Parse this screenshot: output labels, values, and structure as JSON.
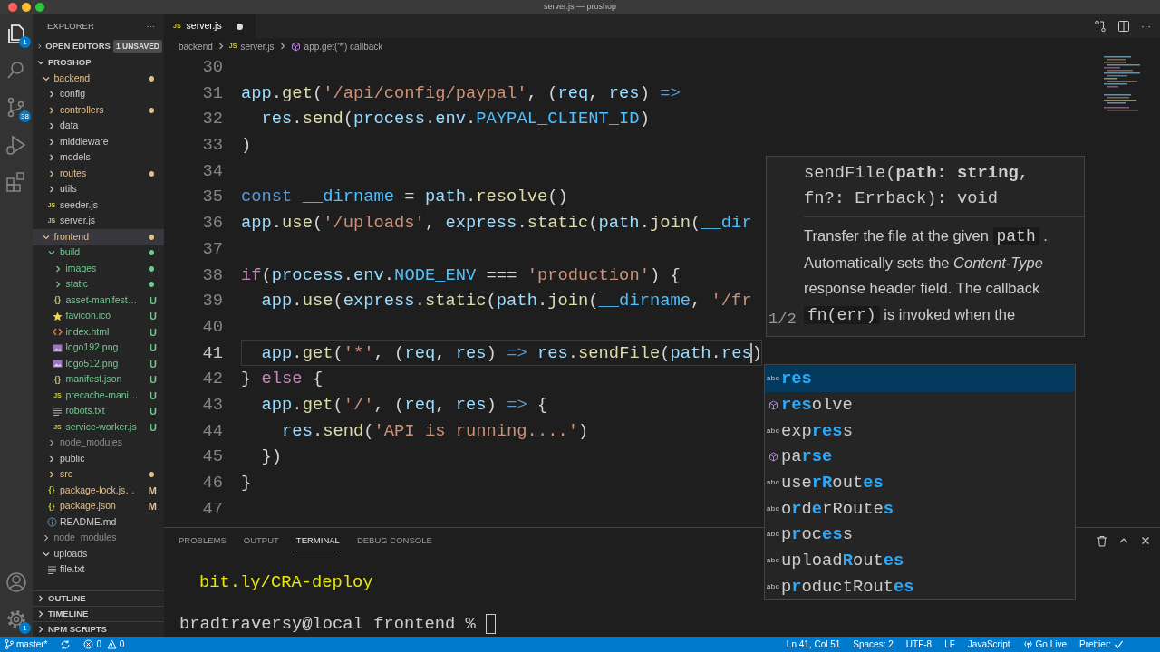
{
  "window": {
    "title": "server.js — proshop"
  },
  "activity_bar": [
    {
      "kind": "explorer",
      "selected": true,
      "badge": "1"
    },
    {
      "kind": "search",
      "selected": false
    },
    {
      "kind": "source_control",
      "selected": false,
      "badge": "38"
    },
    {
      "kind": "run",
      "selected": false
    },
    {
      "kind": "extensions",
      "selected": false
    },
    {
      "kind": "accounts",
      "selected": false
    },
    {
      "kind": "settings",
      "selected": false,
      "badge": "1"
    }
  ],
  "sidebar": {
    "title": "EXPLORER",
    "more": "···",
    "open_editors": {
      "label": "OPEN EDITORS",
      "badge": "1 UNSAVED",
      "expanded": false
    },
    "tree": {
      "label": "PROSHOP",
      "expanded": true,
      "children": [
        {
          "kind": "folder",
          "label": "backend",
          "expanded": true,
          "selected": false,
          "color": "#e2c08d",
          "dot": true,
          "children": [
            {
              "kind": "folder",
              "label": "config",
              "expanded": false,
              "selected": false
            },
            {
              "kind": "folder",
              "label": "controllers",
              "expanded": false,
              "selected": false,
              "color": "#e2c08d",
              "dot": true
            },
            {
              "kind": "folder",
              "label": "data",
              "expanded": false,
              "selected": false
            },
            {
              "kind": "folder",
              "label": "middleware",
              "expanded": false,
              "selected": false
            },
            {
              "kind": "folder",
              "label": "models",
              "expanded": false,
              "selected": false
            },
            {
              "kind": "folder",
              "label": "routes",
              "expanded": false,
              "selected": false,
              "color": "#e2c08d",
              "dot": true
            },
            {
              "kind": "folder",
              "label": "utils",
              "expanded": false,
              "selected": false
            },
            {
              "kind": "script",
              "glyph": "JS",
              "label": "seeder.js",
              "selected": false
            },
            {
              "kind": "script",
              "glyph": "JS",
              "label": "server.js",
              "selected": false
            }
          ]
        },
        {
          "kind": "folder",
          "label": "frontend",
          "expanded": true,
          "selected": true,
          "color": "#e2c08d",
          "dot": true,
          "children": [
            {
              "kind": "folder",
              "label": "build",
              "expanded": true,
              "selected": false,
              "color": "#73c991",
              "dot": true,
              "children": [
                {
                  "kind": "folder",
                  "label": "images",
                  "expanded": false,
                  "selected": false,
                  "color": "#73c991",
                  "dot": true
                },
                {
                  "kind": "folder",
                  "label": "static",
                  "expanded": false,
                  "selected": false,
                  "color": "#73c991",
                  "dot": true
                },
                {
                  "kind": "data",
                  "glyph": "{}",
                  "label": "asset-manifest…",
                  "selected": false,
                  "color": "#73c991",
                  "badge": "U"
                },
                {
                  "kind": "favicon",
                  "label": "favicon.ico",
                  "selected": false,
                  "color": "#73c991",
                  "badge": "U"
                },
                {
                  "kind": "markup",
                  "label": "index.html",
                  "selected": false,
                  "color": "#73c991",
                  "badge": "U"
                },
                {
                  "kind": "image",
                  "label": "logo192.png",
                  "selected": false,
                  "color": "#73c991",
                  "badge": "U"
                },
                {
                  "kind": "image",
                  "label": "logo512.png",
                  "selected": false,
                  "color": "#73c991",
                  "badge": "U"
                },
                {
                  "kind": "data",
                  "glyph": "{}",
                  "label": "manifest.json",
                  "selected": false,
                  "color": "#73c991",
                  "badge": "U"
                },
                {
                  "kind": "script",
                  "glyph": "JS",
                  "label": "precache-mani…",
                  "selected": false,
                  "color": "#73c991",
                  "badge": "U"
                },
                {
                  "kind": "text",
                  "label": "robots.txt",
                  "selected": false,
                  "color": "#73c991",
                  "badge": "U"
                },
                {
                  "kind": "script",
                  "glyph": "JS",
                  "label": "service-worker.js",
                  "selected": false,
                  "color": "#73c991",
                  "badge": "U"
                }
              ]
            },
            {
              "kind": "folder",
              "label": "node_modules",
              "expanded": false,
              "selected": false,
              "color": "#8c8c8c"
            },
            {
              "kind": "folder",
              "label": "public",
              "expanded": false,
              "selected": false
            },
            {
              "kind": "folder",
              "label": "src",
              "expanded": false,
              "selected": false,
              "color": "#e2c08d",
              "dot": true
            },
            {
              "kind": "data",
              "glyph": "{}",
              "label": "package-lock.js…",
              "selected": false,
              "color": "#e2c08d",
              "badge": "M"
            },
            {
              "kind": "data",
              "glyph": "{}",
              "label": "package.json",
              "selected": false,
              "color": "#e2c08d",
              "badge": "M"
            },
            {
              "kind": "readme",
              "label": "README.md",
              "selected": false
            }
          ]
        },
        {
          "kind": "folder",
          "label": "node_modules",
          "expanded": false,
          "selected": false,
          "color": "#8c8c8c"
        },
        {
          "kind": "folder",
          "label": "uploads",
          "expanded": true,
          "selected": false,
          "children": [
            {
              "kind": "text",
              "label": "file.txt",
              "selected": false
            }
          ]
        }
      ]
    },
    "sections": [
      {
        "label": "OUTLINE",
        "expanded": false
      },
      {
        "label": "TIMELINE",
        "expanded": false
      },
      {
        "label": "NPM SCRIPTS",
        "expanded": false
      }
    ]
  },
  "tabs": [
    {
      "label": "server.js",
      "glyph": "JS",
      "dirty": true,
      "selected": true
    }
  ],
  "editor_more": "···",
  "breadcrumb": [
    {
      "kind": "folder",
      "label": "backend"
    },
    {
      "kind": "script",
      "glyph": "JS",
      "label": "server.js"
    },
    {
      "kind": "symbol",
      "label": "app.get('*') callback"
    }
  ],
  "editor": {
    "lines": [
      {
        "number": "30",
        "current": false
      },
      {
        "number": "31",
        "current": false,
        "text": "app.get('/api/config/paypal', (req, res) =>"
      },
      {
        "number": "32",
        "current": false,
        "text": "  res.send(process.env.PAYPAL_CLIENT_ID)"
      },
      {
        "number": "33",
        "current": false,
        "text": ")"
      },
      {
        "number": "34",
        "current": false
      },
      {
        "number": "35",
        "current": false,
        "text": "const __dirname = path.resolve()"
      },
      {
        "number": "36",
        "current": false,
        "text": "app.use('/uploads', express.static(path.join(__dir"
      },
      {
        "number": "37",
        "current": false
      },
      {
        "number": "38",
        "current": false,
        "text": "if(process.env.NODE_ENV === 'production') {"
      },
      {
        "number": "39",
        "current": false,
        "text": "  app.use(express.static(path.join(__dirname, '/fr"
      },
      {
        "number": "40",
        "current": false
      },
      {
        "number": "41",
        "current": true,
        "text": "  app.get('*', (req, res) => res.sendFile(path.res)"
      },
      {
        "number": "42",
        "current": false,
        "text": "} else {"
      },
      {
        "number": "43",
        "current": false,
        "text": "  app.get('/', (req, res) => {"
      },
      {
        "number": "44",
        "current": false,
        "text": "    res.send('API is running....')"
      },
      {
        "number": "45",
        "current": false,
        "text": "  })"
      },
      {
        "number": "46",
        "current": false,
        "text": "}"
      },
      {
        "number": "47",
        "current": false
      }
    ]
  },
  "hover": {
    "signature": [
      "sendFile(**path: string**,",
      "fn?: Errback): void"
    ],
    "paragraphs": [
      [
        {
          "kind": "text",
          "text": "Transfer the file at the given"
        },
        {
          "kind": "code",
          "text": "path"
        },
        {
          "kind": "text",
          "text": "."
        }
      ],
      [
        {
          "kind": "text",
          "text": "Automatically sets the *Content-Type* response header field. The callback"
        },
        {
          "kind": "code",
          "text": "fn(err)"
        },
        {
          "kind": "text",
          "text": "is invoked when the"
        }
      ]
    ],
    "counter": "1/2"
  },
  "suggestions": [
    {
      "kind": "word",
      "icon_text": "abc",
      "label": "**res**",
      "selected": true
    },
    {
      "kind": "method",
      "label": "**res**olve",
      "selected": false
    },
    {
      "kind": "word",
      "icon_text": "abc",
      "label": "exp**res**s",
      "selected": false
    },
    {
      "kind": "method",
      "label": "pa**rse**",
      "selected": false
    },
    {
      "kind": "word",
      "icon_text": "abc",
      "label": "use**rR**out**es**",
      "selected": false
    },
    {
      "kind": "word",
      "icon_text": "abc",
      "label": "o**r**d**e**rRoute**s**",
      "selected": false
    },
    {
      "kind": "word",
      "icon_text": "abc",
      "label": "p**r**oc**es**s",
      "selected": false
    },
    {
      "kind": "word",
      "icon_text": "abc",
      "label": "upload**R**out**es**",
      "selected": false
    },
    {
      "kind": "word",
      "icon_text": "abc",
      "label": "p**r**oductRout**es**",
      "selected": false
    }
  ],
  "panel": {
    "tabs": [
      {
        "label": "PROBLEMS",
        "selected": false
      },
      {
        "label": "OUTPUT",
        "selected": false
      },
      {
        "label": "TERMINAL",
        "selected": true
      },
      {
        "label": "DEBUG CONSOLE",
        "selected": false
      }
    ],
    "terminal": [
      {
        "kind": "output",
        "text": "bit.ly/CRA-deploy"
      },
      {
        "kind": "prompt",
        "text": "bradtraversy@local frontend %"
      }
    ]
  },
  "status_bar": {
    "branch": "master*",
    "errors": "0",
    "warnings": "0",
    "right": [
      {
        "kind": "text",
        "text": "Ln 41, Col 51"
      },
      {
        "kind": "text",
        "text": "Spaces: 2"
      },
      {
        "kind": "text",
        "text": "UTF-8"
      },
      {
        "kind": "text",
        "text": "LF"
      },
      {
        "kind": "text",
        "text": "JavaScript"
      },
      {
        "kind": "go_live",
        "text": "Go Live"
      },
      {
        "kind": "prettier",
        "text": "Prettier:"
      }
    ]
  }
}
